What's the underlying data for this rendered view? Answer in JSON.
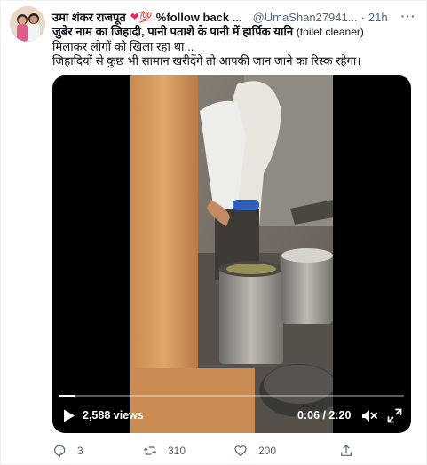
{
  "tweet": {
    "author_name": "उमा शंकर राजपूत",
    "author_emoji": "💯",
    "author_suffix": "%follow back ...",
    "handle": "@UmaShan27941...",
    "separator": "·",
    "time": "21h",
    "more_label": "···",
    "text_lines": [
      "जुबेर नाम का जिहादी, पानी पताशे के पानी में हार्पिक  यानि ",
      "(toilet cleaner)",
      "मिलाकर लोगों को खिला रहा था...",
      "जिहादियों से कुछ भी सामान खरीदेंगे तो आपकी जान जाने का रिस्क रहेगा।"
    ]
  },
  "video": {
    "views": "2,588 views",
    "time_display": "0:06 / 2:20",
    "progress_fraction": 0.043
  },
  "actions": {
    "reply_count": "3",
    "retweet_count": "310",
    "like_count": "200"
  },
  "colors": {
    "text_primary": "#0f1419",
    "text_secondary": "#536471",
    "emoji_red": "#d7263d",
    "border": "#eff3f4"
  }
}
